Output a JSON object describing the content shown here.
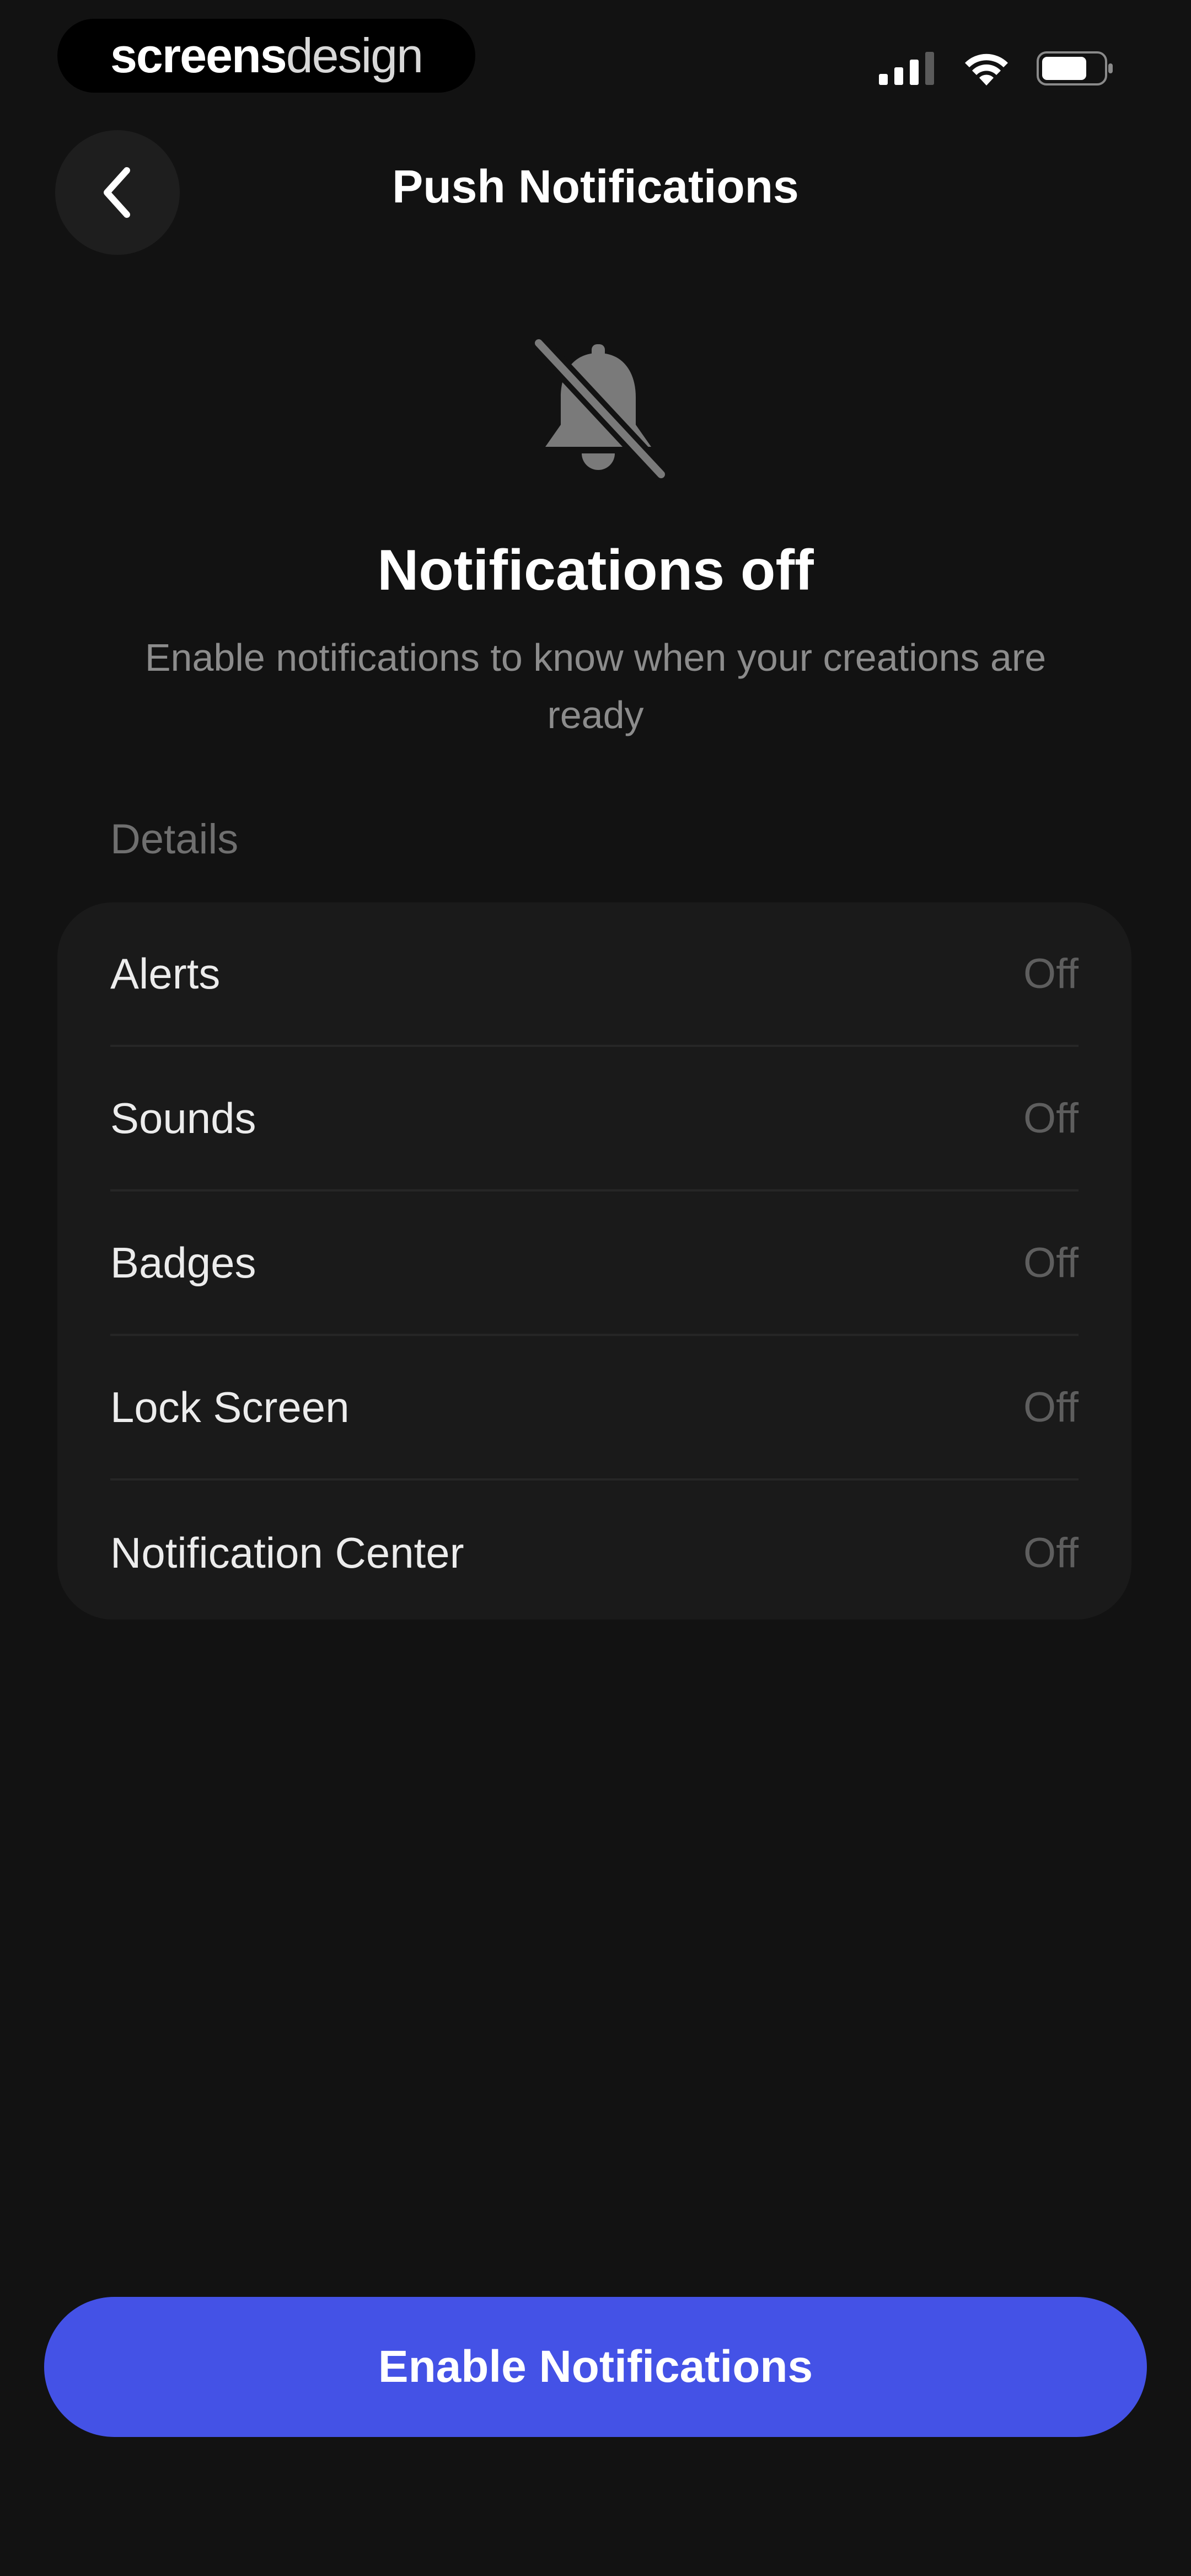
{
  "status_bar": {
    "watermark_bold": "screens",
    "watermark_light": "design",
    "icons": [
      "cellular-signal-icon",
      "wifi-icon",
      "battery-icon"
    ]
  },
  "header": {
    "title": "Push Notifications",
    "back_icon": "chevron-left-icon"
  },
  "hero": {
    "icon": "bell-slash-icon",
    "title": "Notifications off",
    "subtitle": "Enable notifications to know when your creations are ready"
  },
  "details": {
    "section_label": "Details",
    "rows": [
      {
        "label": "Alerts",
        "value": "Off"
      },
      {
        "label": "Sounds",
        "value": "Off"
      },
      {
        "label": "Badges",
        "value": "Off"
      },
      {
        "label": "Lock Screen",
        "value": "Off"
      },
      {
        "label": "Notification Center",
        "value": "Off"
      }
    ]
  },
  "cta": {
    "label": "Enable Notifications"
  },
  "colors": {
    "background": "#121212",
    "card": "#1a1a1a",
    "accent": "#4452e6",
    "muted_text": "#8c8c8c"
  }
}
